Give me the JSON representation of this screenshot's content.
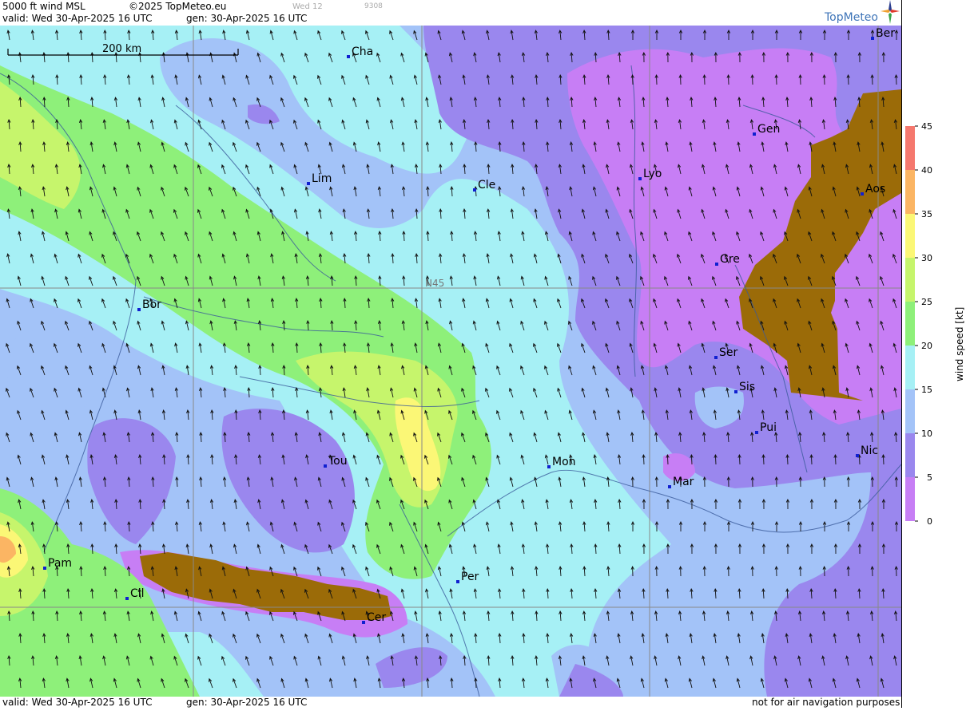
{
  "header": {
    "product": "5000 ft wind MSL",
    "copyright": "©2025 TopMeteo.eu",
    "faded_day": "Wed 12",
    "faded_code": "9308",
    "valid_line": "valid:  Wed  30-Apr-2025  16 UTC",
    "gen_line": "gen:  30-Apr-2025  16 UTC",
    "logo_text": "TopMeteo"
  },
  "footer": {
    "valid_line": "valid:  Wed  30-Apr-2025  16 UTC",
    "gen_line": "gen:  30-Apr-2025  16 UTC",
    "disclaimer": "not for air navigation purposes"
  },
  "map": {
    "scale_label": "200 km",
    "parallel_label": "N45",
    "cities": [
      {
        "name": "Cha"
      },
      {
        "name": "Ber"
      },
      {
        "name": "Gen"
      },
      {
        "name": "Lim"
      },
      {
        "name": "Cle"
      },
      {
        "name": "Lyo"
      },
      {
        "name": "Aos"
      },
      {
        "name": "Gre"
      },
      {
        "name": "Bor"
      },
      {
        "name": "Ser"
      },
      {
        "name": "Sis"
      },
      {
        "name": "Pui"
      },
      {
        "name": "Tou"
      },
      {
        "name": "Mon"
      },
      {
        "name": "Nic"
      },
      {
        "name": "Mar"
      },
      {
        "name": "Pam"
      },
      {
        "name": "Cil"
      },
      {
        "name": "Per"
      },
      {
        "name": "Cer"
      }
    ]
  },
  "legend": {
    "title": "wind  speed  [kt]",
    "ticks": [
      "45",
      "40",
      "35",
      "30",
      "25",
      "20",
      "15",
      "10",
      "5",
      "0"
    ],
    "colors": {
      "0_5": "#c77ef5",
      "5_10": "#9a87ee",
      "10_15": "#a3c3f8",
      "15_20": "#a6f0f5",
      "20_25": "#8ef07a",
      "25_30": "#c6f56c",
      "30_35": "#fbf776",
      "35_40": "#fbb563",
      "40_45": "#f5786e",
      "terrain": "#9b6b08"
    }
  }
}
